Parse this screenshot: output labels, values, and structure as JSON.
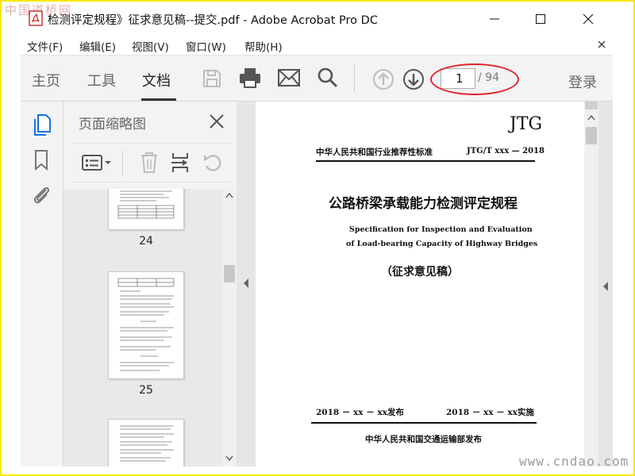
{
  "watermarks": {
    "top_left": "中国道桥网",
    "bottom_right": "www.cndao.com"
  },
  "window": {
    "title": "检测评定规程》征求意见稿--提交.pdf - Adobe Acrobat Pro DC"
  },
  "menu": [
    "文件(F)",
    "编辑(E)",
    "视图(V)",
    "窗口(W)",
    "帮助(H)"
  ],
  "toolbar": {
    "tabs": [
      {
        "label": "主页",
        "active": false
      },
      {
        "label": "工具",
        "active": false
      },
      {
        "label": "文档",
        "active": true
      }
    ],
    "icons": [
      "save-icon",
      "print-icon",
      "email-icon",
      "search-icon",
      "prev-page-icon",
      "next-page-icon"
    ],
    "page_current": "1",
    "page_total": "/ 94",
    "login_label": "登录",
    "highlight_color": "#e0252a"
  },
  "side_nav": {
    "icons": [
      "pages-icon",
      "bookmark-icon",
      "attachment-icon"
    ],
    "active_color": "#1473e6"
  },
  "thumbnail_panel": {
    "title": "页面缩略图",
    "tool_icons": [
      "options-icon",
      "delete-icon",
      "insert-icon",
      "rotate-icon"
    ],
    "thumbnails": [
      {
        "page_number": "24"
      },
      {
        "page_number": "25"
      }
    ]
  },
  "document": {
    "badge": "JTG",
    "header_left": "中华人民共和国行业推荐性标准",
    "header_right": "JTG/T xxx — 2018",
    "title_cn": "公路桥梁承载能力检测评定规程",
    "title_en_line1": "Specification for Inspection and Evaluation",
    "title_en_line2": "of Load-bearing Capacity of Highway Bridges",
    "draft_note": "（征求意见稿）",
    "publish_date": "2018 － xx － xx发布",
    "effective_date": "2018 － xx － xx实施",
    "publisher": "中华人民共和国交通运输部发布"
  }
}
